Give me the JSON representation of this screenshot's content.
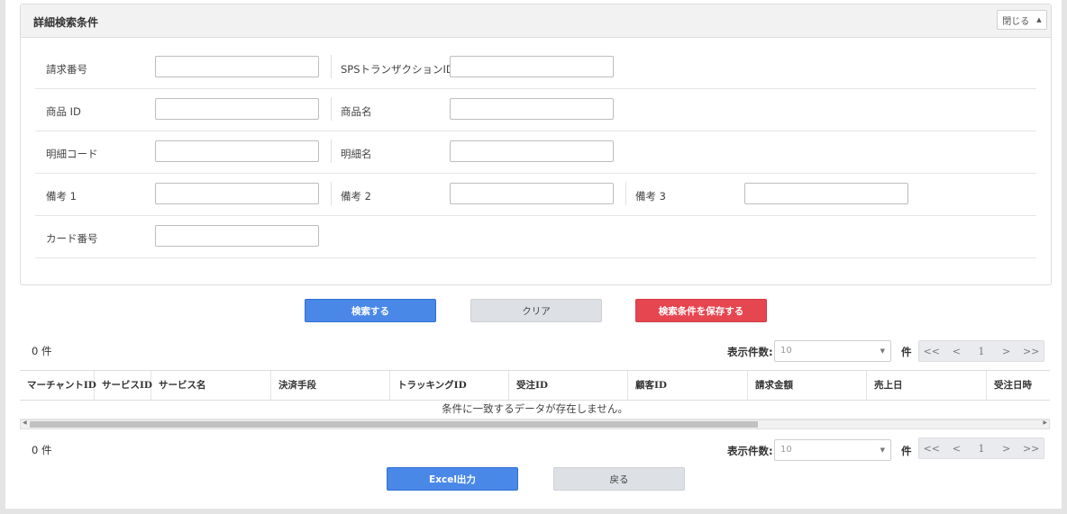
{
  "panel": {
    "title": "詳細検索条件",
    "close_label": "閉じる",
    "fields": [
      {
        "label": "請求番号",
        "value": ""
      },
      {
        "label": "SPSトランザクションID",
        "value": ""
      },
      {
        "label": "商品 ID",
        "value": ""
      },
      {
        "label": "商品名",
        "value": ""
      },
      {
        "label": "明細コード",
        "value": ""
      },
      {
        "label": "明細名",
        "value": ""
      },
      {
        "label": "備考 1",
        "value": ""
      },
      {
        "label": "備考 2",
        "value": ""
      },
      {
        "label": "備考 3",
        "value": ""
      },
      {
        "label": "カード番号",
        "value": ""
      }
    ]
  },
  "actions": {
    "search": "検索する",
    "clear": "クリア",
    "save": "検索条件を保存する"
  },
  "results": {
    "count_text": "0 件",
    "per_page_label": "表示件数:",
    "per_page_value": "10",
    "ken": "件",
    "pager": [
      "<<",
      "<",
      "1",
      ">",
      ">>"
    ],
    "columns": [
      "マーチャントID",
      "サービスID",
      "サービス名",
      "決済手段",
      "トラッキングID",
      "受注ID",
      "顧客ID",
      "請求金額",
      "売上日",
      "受注日時"
    ],
    "empty_message": "条件に一致するデータが存在しません。"
  },
  "footer": {
    "excel": "Excel出力",
    "back": "戻る"
  },
  "colors": {
    "primary": "#4a88e8",
    "danger": "#e64650",
    "neutral": "#dde0e4"
  }
}
